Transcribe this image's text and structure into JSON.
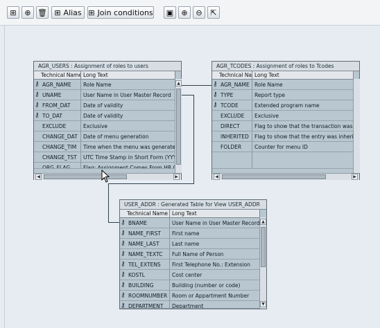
{
  "toolbar": {
    "alias_label": "Alias",
    "join_label": "Join conditions"
  },
  "tables": {
    "agr_users": {
      "title": "AGR_USERS : Assignment of roles to users",
      "col1": "Technical Name",
      "col2": "Long Text",
      "rows": [
        {
          "name": "AGR_NAME",
          "text": "Role Name"
        },
        {
          "name": "UNAME",
          "text": "User Name in User Master Record"
        },
        {
          "name": "FROM_DAT",
          "text": "Date of validity"
        },
        {
          "name": "TO_DAT",
          "text": "Date of validity"
        },
        {
          "name": "EXCLUDE",
          "text": "Exclusive"
        },
        {
          "name": "CHANGE_DAT",
          "text": "Date of menu generation"
        },
        {
          "name": "CHANGE_TIM",
          "text": "Time when the menu was generated in"
        },
        {
          "name": "CHANGE_TST",
          "text": "UTC Time Stamp in Short Form (YYY"
        },
        {
          "name": "ORG_FLAG",
          "text": "Flag: Assignment Comes From HR Org"
        }
      ]
    },
    "agr_tcodes": {
      "title": "AGR_TCODES : Assignment of roles to Tcodes",
      "col1": "Technical Name",
      "col2": "Long Text",
      "rows": [
        {
          "name": "AGR_NAME",
          "text": "Role Name"
        },
        {
          "name": "TYPE",
          "text": "Report type"
        },
        {
          "name": "TCODE",
          "text": "Extended program name"
        },
        {
          "name": "EXCLUDE",
          "text": "Exclusive"
        },
        {
          "name": "DIRECT",
          "text": "Flag to show that the transaction was input"
        },
        {
          "name": "INHERITED",
          "text": "Flag to show that the entry was inherited"
        },
        {
          "name": "FOLDER",
          "text": "Counter for menu ID"
        }
      ]
    },
    "user_addr": {
      "title": "USER_ADDR : Generated Table for View USER_ADDR",
      "col1": "Technical Name",
      "col2": "Long Text",
      "rows": [
        {
          "name": "BNAME",
          "text": "User Name in User Master Record"
        },
        {
          "name": "NAME_FIRST",
          "text": "First name"
        },
        {
          "name": "NAME_LAST",
          "text": "Last name"
        },
        {
          "name": "NAME_TEXTC",
          "text": "Full Name of Person"
        },
        {
          "name": "TEL_EXTENS",
          "text": "First Telephone No.: Extension"
        },
        {
          "name": "KOSTL",
          "text": "Cost center"
        },
        {
          "name": "BUILDING",
          "text": "Building (number or code)"
        },
        {
          "name": "ROOMNUMBER",
          "text": "Room or Appartment Number"
        },
        {
          "name": "DEPARTMENT",
          "text": "Department"
        }
      ]
    }
  }
}
